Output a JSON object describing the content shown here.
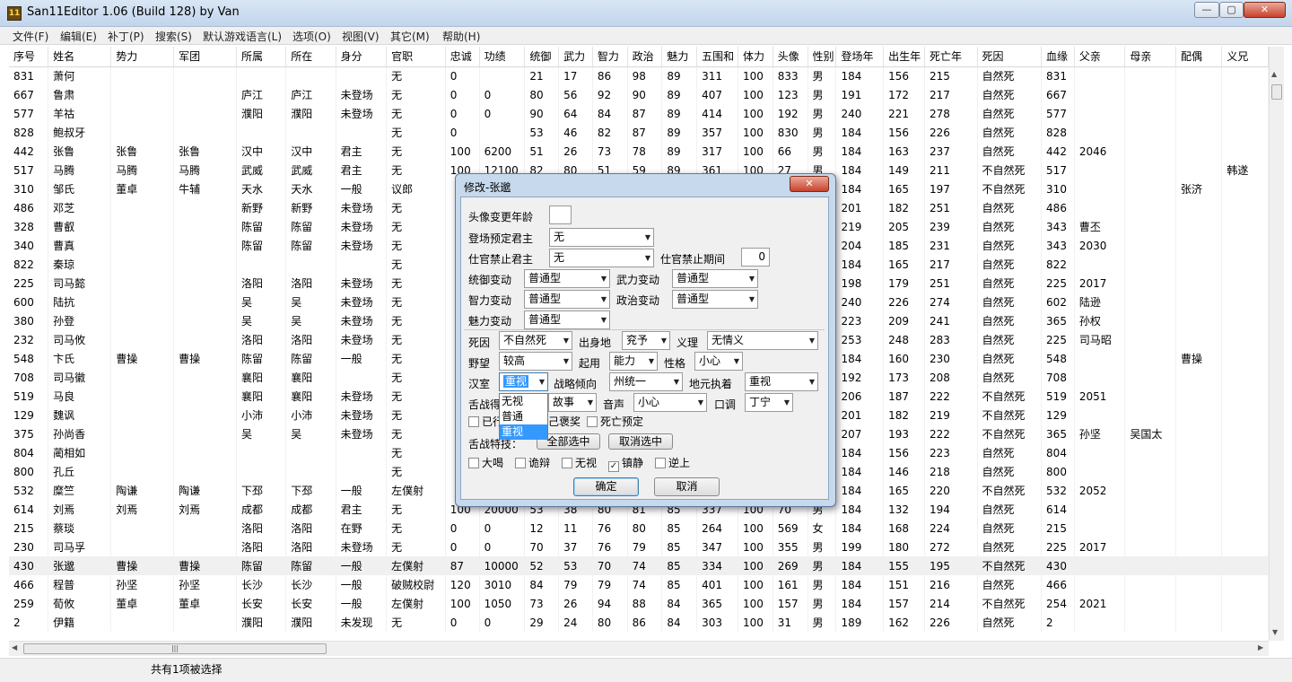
{
  "window": {
    "title": "San11Editor 1.06 (Build 128) by Van",
    "icon": "11",
    "min_label": "—",
    "max_label": "▢",
    "close_label": "✕"
  },
  "menu": [
    "文件(F)",
    "编辑(E)",
    "补丁(P)",
    "搜索(S)",
    "默认游戏语言(L)",
    "选项(O)",
    "视图(V)",
    "其它(M)",
    "帮助(H)"
  ],
  "table": {
    "columns": [
      "序号",
      "姓名",
      "势力",
      "军团",
      "所属",
      "所在",
      "身分",
      "官职",
      "忠诚",
      "功绩",
      "统御",
      "武力",
      "智力",
      "政治",
      "魅力",
      "五围和",
      "体力",
      "头像",
      "性别",
      "登场年",
      "出生年",
      "死亡年",
      "死因",
      "血缘",
      "父亲",
      "母亲",
      "配偶",
      "义兄"
    ],
    "rows": [
      [
        "831",
        "萧何",
        "",
        "",
        "",
        "",
        "",
        "无",
        "0",
        "",
        "21",
        "17",
        "86",
        "98",
        "89",
        "311",
        "100",
        "833",
        "男",
        "184",
        "156",
        "215",
        "自然死",
        "831",
        "",
        "",
        "",
        ""
      ],
      [
        "667",
        "鲁肃",
        "",
        "",
        "庐江",
        "庐江",
        "未登场",
        "无",
        "0",
        "0",
        "80",
        "56",
        "92",
        "90",
        "89",
        "407",
        "100",
        "123",
        "男",
        "191",
        "172",
        "217",
        "自然死",
        "667",
        "",
        "",
        "",
        ""
      ],
      [
        "577",
        "羊祜",
        "",
        "",
        "濮阳",
        "濮阳",
        "未登场",
        "无",
        "0",
        "0",
        "90",
        "64",
        "84",
        "87",
        "89",
        "414",
        "100",
        "192",
        "男",
        "240",
        "221",
        "278",
        "自然死",
        "577",
        "",
        "",
        "",
        ""
      ],
      [
        "828",
        "鲍叔牙",
        "",
        "",
        "",
        "",
        "",
        "无",
        "0",
        "",
        "53",
        "46",
        "82",
        "87",
        "89",
        "357",
        "100",
        "830",
        "男",
        "184",
        "156",
        "226",
        "自然死",
        "828",
        "",
        "",
        "",
        ""
      ],
      [
        "442",
        "张鲁",
        "张鲁",
        "张鲁",
        "汉中",
        "汉中",
        "君主",
        "无",
        "100",
        "6200",
        "51",
        "26",
        "73",
        "78",
        "89",
        "317",
        "100",
        "66",
        "男",
        "184",
        "163",
        "237",
        "自然死",
        "442",
        "2046",
        "",
        "",
        ""
      ],
      [
        "517",
        "马腾",
        "马腾",
        "马腾",
        "武威",
        "武威",
        "君主",
        "无",
        "100",
        "12100",
        "82",
        "80",
        "51",
        "59",
        "89",
        "361",
        "100",
        "27",
        "男",
        "184",
        "149",
        "211",
        "不自然死",
        "517",
        "",
        "",
        "",
        "韩遂"
      ],
      [
        "310",
        "邹氏",
        "董卓",
        "牛辅",
        "天水",
        "天水",
        "一般",
        "议郎",
        "",
        "",
        "",
        "",
        "",
        "",
        "",
        "",
        "",
        "",
        "",
        "184",
        "165",
        "197",
        "不自然死",
        "310",
        "",
        "",
        "张济",
        ""
      ],
      [
        "486",
        "邓芝",
        "",
        "",
        "新野",
        "新野",
        "未登场",
        "无",
        "",
        "",
        "",
        "",
        "",
        "",
        "",
        "",
        "",
        "",
        "",
        "201",
        "182",
        "251",
        "自然死",
        "486",
        "",
        "",
        "",
        ""
      ],
      [
        "328",
        "曹叡",
        "",
        "",
        "陈留",
        "陈留",
        "未登场",
        "无",
        "",
        "",
        "",
        "",
        "",
        "",
        "",
        "",
        "",
        "",
        "",
        "219",
        "205",
        "239",
        "自然死",
        "343",
        "曹丕",
        "",
        "",
        ""
      ],
      [
        "340",
        "曹真",
        "",
        "",
        "陈留",
        "陈留",
        "未登场",
        "无",
        "",
        "",
        "",
        "",
        "",
        "",
        "",
        "",
        "",
        "",
        "",
        "204",
        "185",
        "231",
        "自然死",
        "343",
        "2030",
        "",
        "",
        ""
      ],
      [
        "822",
        "秦琼",
        "",
        "",
        "",
        "",
        "",
        "无",
        "",
        "",
        "",
        "",
        "",
        "",
        "",
        "",
        "",
        "",
        "",
        "184",
        "165",
        "217",
        "自然死",
        "822",
        "",
        "",
        "",
        ""
      ],
      [
        "225",
        "司马懿",
        "",
        "",
        "洛阳",
        "洛阳",
        "未登场",
        "无",
        "",
        "",
        "",
        "",
        "",
        "",
        "",
        "",
        "",
        "",
        "",
        "198",
        "179",
        "251",
        "自然死",
        "225",
        "2017",
        "",
        "",
        ""
      ],
      [
        "600",
        "陆抗",
        "",
        "",
        "吴",
        "吴",
        "未登场",
        "无",
        "",
        "",
        "",
        "",
        "",
        "",
        "",
        "",
        "",
        "",
        "",
        "240",
        "226",
        "274",
        "自然死",
        "602",
        "陆逊",
        "",
        "",
        ""
      ],
      [
        "380",
        "孙登",
        "",
        "",
        "吴",
        "吴",
        "未登场",
        "无",
        "",
        "",
        "",
        "",
        "",
        "",
        "",
        "",
        "",
        "",
        "",
        "223",
        "209",
        "241",
        "自然死",
        "365",
        "孙权",
        "",
        "",
        ""
      ],
      [
        "232",
        "司马攸",
        "",
        "",
        "洛阳",
        "洛阳",
        "未登场",
        "无",
        "",
        "",
        "",
        "",
        "",
        "",
        "",
        "",
        "",
        "",
        "",
        "253",
        "248",
        "283",
        "自然死",
        "225",
        "司马昭",
        "",
        "",
        ""
      ],
      [
        "548",
        "卞氏",
        "曹操",
        "曹操",
        "陈留",
        "陈留",
        "一般",
        "无",
        "",
        "",
        "",
        "",
        "",
        "",
        "",
        "",
        "",
        "",
        "",
        "184",
        "160",
        "230",
        "自然死",
        "548",
        "",
        "",
        "曹操",
        ""
      ],
      [
        "708",
        "司马徽",
        "",
        "",
        "襄阳",
        "襄阳",
        "",
        "无",
        "",
        "",
        "",
        "",
        "",
        "",
        "",
        "",
        "",
        "",
        "",
        "192",
        "173",
        "208",
        "自然死",
        "708",
        "",
        "",
        "",
        ""
      ],
      [
        "519",
        "马良",
        "",
        "",
        "襄阳",
        "襄阳",
        "未登场",
        "无",
        "",
        "",
        "",
        "",
        "",
        "",
        "",
        "",
        "",
        "",
        "",
        "206",
        "187",
        "222",
        "不自然死",
        "519",
        "2051",
        "",
        "",
        ""
      ],
      [
        "129",
        "魏讽",
        "",
        "",
        "小沛",
        "小沛",
        "未登场",
        "无",
        "",
        "",
        "",
        "",
        "",
        "",
        "",
        "",
        "",
        "",
        "",
        "201",
        "182",
        "219",
        "不自然死",
        "129",
        "",
        "",
        "",
        ""
      ],
      [
        "375",
        "孙尚香",
        "",
        "",
        "吴",
        "吴",
        "未登场",
        "无",
        "",
        "",
        "",
        "",
        "",
        "",
        "",
        "",
        "",
        "",
        "",
        "207",
        "193",
        "222",
        "不自然死",
        "365",
        "孙坚",
        "吴国太",
        "",
        ""
      ],
      [
        "804",
        "蔺相如",
        "",
        "",
        "",
        "",
        "",
        "无",
        "",
        "",
        "",
        "",
        "",
        "",
        "",
        "",
        "",
        "",
        "",
        "184",
        "156",
        "223",
        "自然死",
        "804",
        "",
        "",
        "",
        ""
      ],
      [
        "800",
        "孔丘",
        "",
        "",
        "",
        "",
        "",
        "无",
        "",
        "",
        "",
        "",
        "",
        "",
        "",
        "",
        "",
        "",
        "",
        "184",
        "146",
        "218",
        "自然死",
        "800",
        "",
        "",
        "",
        ""
      ],
      [
        "532",
        "糜竺",
        "陶谦",
        "陶谦",
        "下邳",
        "下邳",
        "一般",
        "左僕射",
        "",
        "",
        "",
        "",
        "",
        "",
        "",
        "",
        "",
        "",
        "",
        "184",
        "165",
        "220",
        "不自然死",
        "532",
        "2052",
        "",
        "",
        ""
      ],
      [
        "614",
        "刘焉",
        "刘焉",
        "刘焉",
        "成都",
        "成都",
        "君主",
        "无",
        "100",
        "20000",
        "53",
        "38",
        "80",
        "81",
        "85",
        "337",
        "100",
        "70",
        "男",
        "184",
        "132",
        "194",
        "自然死",
        "614",
        "",
        "",
        "",
        ""
      ],
      [
        "215",
        "蔡琰",
        "",
        "",
        "洛阳",
        "洛阳",
        "在野",
        "无",
        "0",
        "0",
        "12",
        "11",
        "76",
        "80",
        "85",
        "264",
        "100",
        "569",
        "女",
        "184",
        "168",
        "224",
        "自然死",
        "215",
        "",
        "",
        "",
        ""
      ],
      [
        "230",
        "司马孚",
        "",
        "",
        "洛阳",
        "洛阳",
        "未登场",
        "无",
        "0",
        "0",
        "70",
        "37",
        "76",
        "79",
        "85",
        "347",
        "100",
        "355",
        "男",
        "199",
        "180",
        "272",
        "自然死",
        "225",
        "2017",
        "",
        "",
        ""
      ],
      [
        "430",
        "张邈",
        "曹操",
        "曹操",
        "陈留",
        "陈留",
        "一般",
        "左僕射",
        "87",
        "10000",
        "52",
        "53",
        "70",
        "74",
        "85",
        "334",
        "100",
        "269",
        "男",
        "184",
        "155",
        "195",
        "不自然死",
        "430",
        "",
        "",
        "",
        ""
      ],
      [
        "466",
        "程普",
        "孙坚",
        "孙坚",
        "长沙",
        "长沙",
        "一般",
        "破贼校尉",
        "120",
        "3010",
        "84",
        "79",
        "79",
        "74",
        "85",
        "401",
        "100",
        "161",
        "男",
        "184",
        "151",
        "216",
        "自然死",
        "466",
        "",
        "",
        "",
        ""
      ],
      [
        "259",
        "荀攸",
        "董卓",
        "董卓",
        "长安",
        "长安",
        "一般",
        "左僕射",
        "100",
        "1050",
        "73",
        "26",
        "94",
        "88",
        "84",
        "365",
        "100",
        "157",
        "男",
        "184",
        "157",
        "214",
        "不自然死",
        "254",
        "2021",
        "",
        "",
        ""
      ],
      [
        "2",
        "伊籍",
        "",
        "",
        "濮阳",
        "濮阳",
        "未发现",
        "无",
        "0",
        "0",
        "29",
        "24",
        "80",
        "86",
        "84",
        "303",
        "100",
        "31",
        "男",
        "189",
        "162",
        "226",
        "自然死",
        "2",
        "",
        "",
        "",
        ""
      ]
    ],
    "selected_row": 26
  },
  "statusbar": {
    "text": "共有1项被选择"
  },
  "dialog": {
    "title": "修改-张邈",
    "close_label": "✕",
    "portrait_age_label": "头像变更年龄",
    "portrait_age_value": "",
    "appear_lord_label": "登场预定君主",
    "appear_lord_value": "无",
    "ban_lord_label": "仕官禁止君主",
    "ban_lord_value": "无",
    "ban_period_label": "仕官禁止期间",
    "ban_period_value": "0",
    "lead_change_label": "统御变动",
    "lead_change_value": "普通型",
    "war_change_label": "武力变动",
    "war_change_value": "普通型",
    "int_change_label": "智力变动",
    "int_change_value": "普通型",
    "pol_change_label": "政治变动",
    "pol_change_value": "普通型",
    "chr_change_label": "魅力变动",
    "chr_change_value": "普通型",
    "death_label": "死因",
    "death_value": "不自然死",
    "origin_label": "出身地",
    "origin_value": "兖予",
    "justice_label": "义理",
    "justice_value": "无情义",
    "ambition_label": "野望",
    "ambition_value": "较高",
    "employ_label": "起用",
    "employ_value": "能力",
    "personality_label": "性格",
    "personality_value": "小心",
    "han_label": "汉室",
    "han_value": "重视",
    "strategy_label": "战略倾向",
    "strategy_value": "州统一",
    "local_label": "地元执着",
    "local_value": "重视",
    "debate_label": "舌战得意",
    "debate_value": "故事",
    "voice_label": "音声",
    "voice_value": "小心",
    "tone_label": "口调",
    "tone_value": "丁宁",
    "cb_already_label": "已行",
    "cb_reward_label": "己褒奖",
    "cb_death_label": "死亡预定",
    "debate_skill_label": "舌战特技：",
    "select_all_label": "全部选中",
    "deselect_label": "取消选中",
    "skills": [
      {
        "label": "大喝",
        "checked": false
      },
      {
        "label": "诡辩",
        "checked": false
      },
      {
        "label": "无视",
        "checked": false
      },
      {
        "label": "镇静",
        "checked": true
      },
      {
        "label": "逆上",
        "checked": false
      }
    ],
    "ok_label": "确定",
    "cancel_label": "取消",
    "dropdown_options": [
      "无视",
      "普通",
      "重视"
    ],
    "dropdown_selected": "重视"
  }
}
